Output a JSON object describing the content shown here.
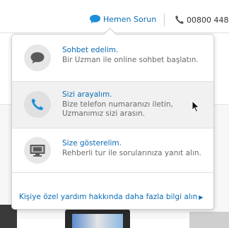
{
  "header": {
    "help_label": "Hemen Sorun",
    "phone_label": "00800 448"
  },
  "popup": {
    "options": [
      {
        "title": "Sohbet edelim.",
        "description": "Bir Uzman ile online sohbet başlatın.",
        "icon": "chat-bubble-icon"
      },
      {
        "title": "Sizi arayalım.",
        "description": "Bize telefon numaranızı iletin, Uzmanımız sizi arasın.",
        "icon": "phone-icon"
      },
      {
        "title": "Size gösterelim.",
        "description": "Rehberli tur ile sorularınıza yanıt alın.",
        "icon": "screen-share-icon"
      }
    ],
    "more_link": "Kişiye özel yardım hakkında daha fazla bilgi alın"
  },
  "colors": {
    "link": "#0a6cb5",
    "description": "#6a6a6a",
    "hover_background": "#f1f1f1"
  }
}
